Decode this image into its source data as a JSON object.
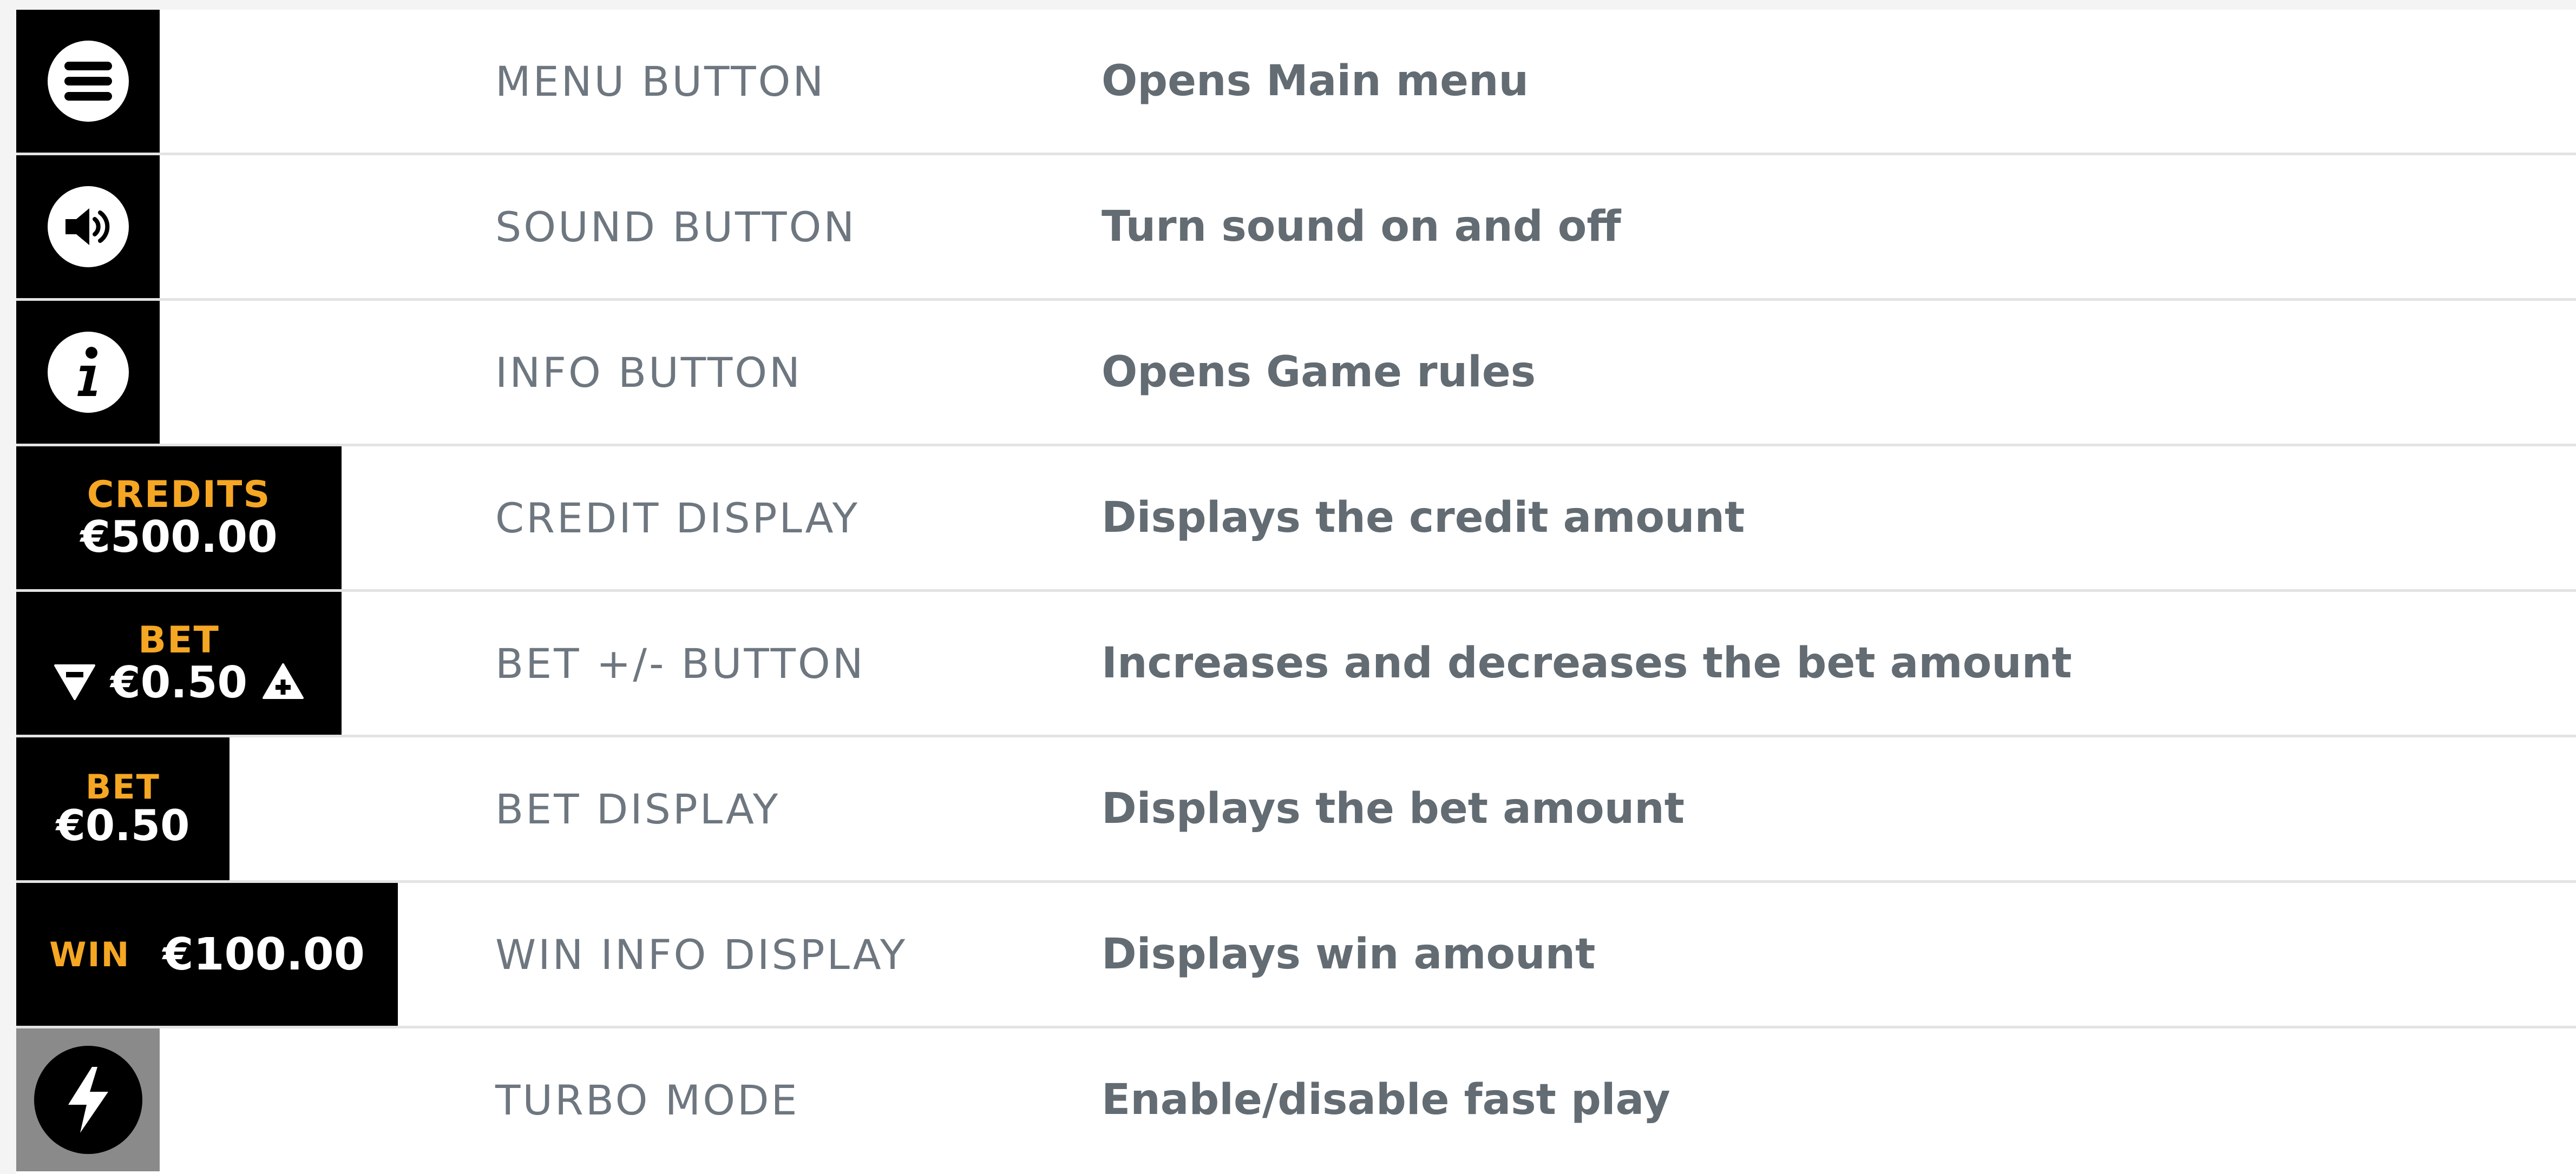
{
  "colors": {
    "icon_bg": "#000000",
    "turbo_bg": "#8a8a8a",
    "accent": "#f5a623",
    "label_text": "#6e7780",
    "desc_text": "#636c73"
  },
  "rows": [
    {
      "icon": "menu-icon",
      "label": "MENU BUTTON",
      "desc": "Opens Main menu"
    },
    {
      "icon": "sound-icon",
      "label": "SOUND BUTTON",
      "desc": "Turn sound on and off"
    },
    {
      "icon": "info-icon",
      "label": "INFO BUTTON",
      "desc": "Opens Game rules"
    },
    {
      "caption": "CREDITS",
      "amount": "€500.00",
      "label": "CREDIT DISPLAY",
      "desc": "Displays the credit amount"
    },
    {
      "caption": "BET",
      "amount": "€0.50",
      "label": "BET +/- BUTTON",
      "desc": "Increases and decreases the bet amount"
    },
    {
      "caption": "BET",
      "amount": "€0.50",
      "label": "BET DISPLAY",
      "desc": "Displays the bet amount"
    },
    {
      "caption": "WIN",
      "amount": "€100.00",
      "label": "WIN INFO DISPLAY",
      "desc": "Displays win amount"
    },
    {
      "icon": "lightning-icon",
      "label": "TURBO MODE",
      "desc": "Enable/disable fast play"
    }
  ]
}
